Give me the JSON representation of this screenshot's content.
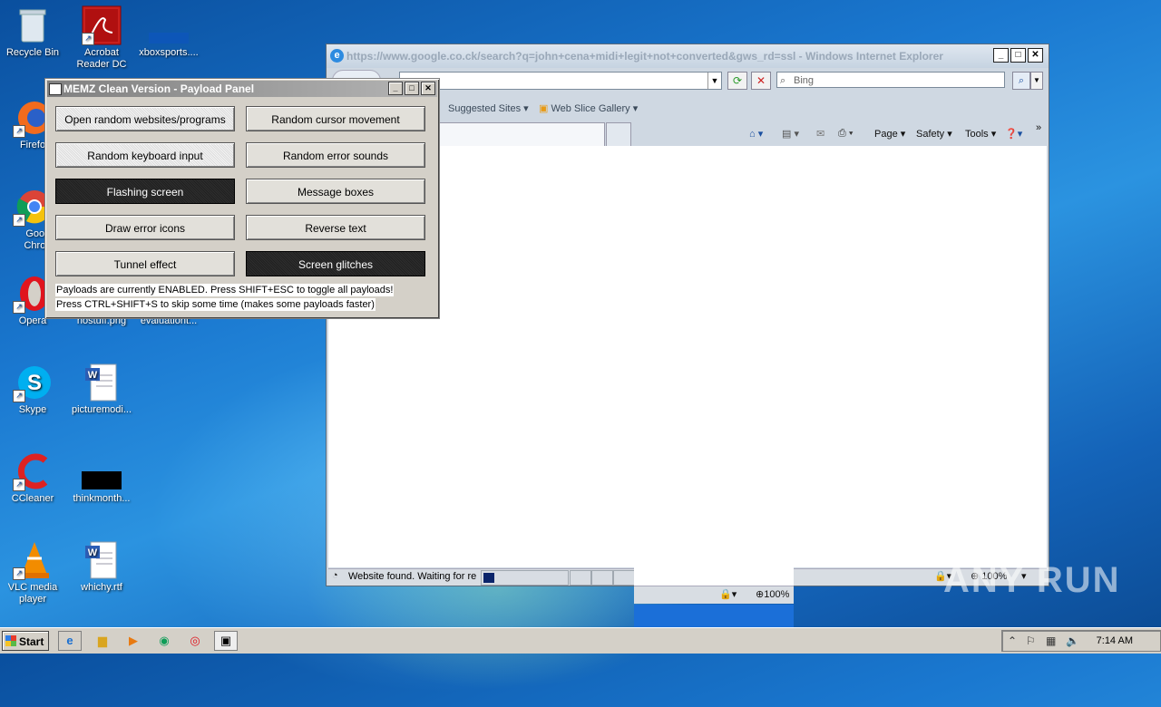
{
  "desktop": {
    "icons": [
      {
        "label": "Recycle Bin",
        "icon": "recycle-bin-icon"
      },
      {
        "label": "Acrobat Reader DC",
        "icon": "acrobat-icon"
      },
      {
        "label": "xboxsports....",
        "icon": "file-icon"
      },
      {
        "label": "Firefo",
        "icon": "firefox-icon"
      },
      {
        "label": "Googl Chrom",
        "icon": "chrome-icon"
      },
      {
        "label": "Opera",
        "icon": "opera-icon"
      },
      {
        "label": "nostuff.png",
        "icon": "image-file-icon"
      },
      {
        "label": "evaluationt...",
        "icon": "file-icon"
      },
      {
        "label": "Skype",
        "icon": "skype-icon"
      },
      {
        "label": "picturemodi...",
        "icon": "word-doc-icon"
      },
      {
        "label": "CCleaner",
        "icon": "ccleaner-icon"
      },
      {
        "label": "thinkmonth...",
        "icon": "file-icon"
      },
      {
        "label": "VLC media player",
        "icon": "vlc-icon"
      },
      {
        "label": "whichy.rtf",
        "icon": "word-doc-icon"
      }
    ]
  },
  "ie_window": {
    "title": "https://www.google.co.ck/search?q=john+cena+midi+legit+not+converted&gws_rd=ssl - Windows Internet Explorer",
    "search_placeholder": "Bing",
    "favorites": [
      "Suggested Sites",
      "Web Slice Gallery"
    ],
    "commands": [
      "Page",
      "Safety",
      "Tools"
    ],
    "status_text": "Website found. Waiting for re",
    "zoom": "100%",
    "zoom_mini": "100%"
  },
  "memz": {
    "title": "MEMZ Clean Version - Payload Panel",
    "buttons": [
      {
        "label": "Open random websites/programs"
      },
      {
        "label": "Random cursor movement"
      },
      {
        "label": "Random keyboard input"
      },
      {
        "label": "Random error sounds"
      },
      {
        "label": "Flashing screen"
      },
      {
        "label": "Message boxes"
      },
      {
        "label": "Draw error icons"
      },
      {
        "label": "Reverse text"
      },
      {
        "label": "Tunnel effect"
      },
      {
        "label": "Screen glitches"
      }
    ],
    "info_line1": "Payloads are currently ENABLED. Press SHIFT+ESC to toggle all payloads!",
    "info_line2": "Press CTRL+SHIFT+S to skip some time (makes some payloads faster)"
  },
  "taskbar": {
    "start_label": "Start",
    "clock": "7:14 AM"
  },
  "watermark": "ANY RUN"
}
